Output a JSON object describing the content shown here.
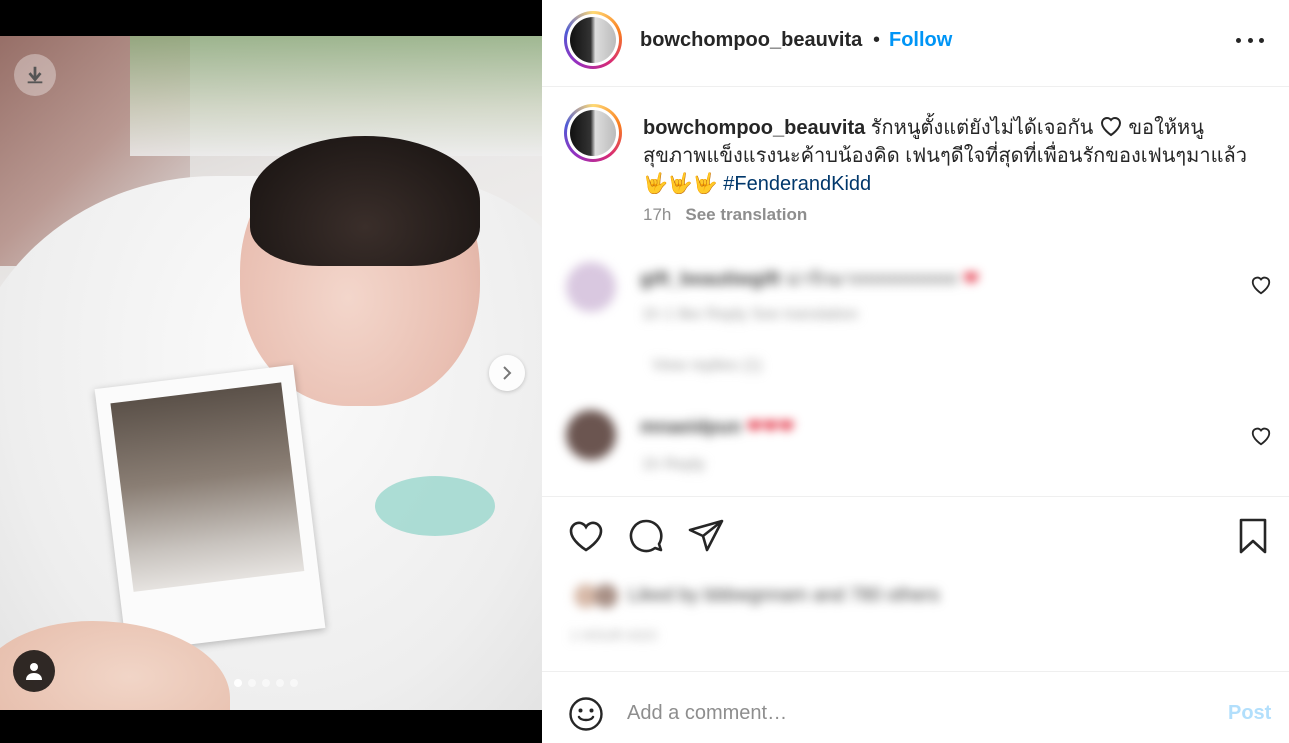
{
  "post": {
    "username": "bowchompoo_beauvita",
    "separator": "•",
    "follow_label": "Follow",
    "more_icon": "more-horizontal-icon"
  },
  "caption": {
    "username": "bowchompoo_beauvita",
    "text_part1": " รักหนูตั้งแต่ยังไม่ได้เจอกัน ",
    "text_part2": " ขอให้หนูสุขภาพแข็งแรงนะค้าบน้องคิด เฟนๆดีใจที่สุดที่เพื่อนรักของเฟนๆมาแล้ว ",
    "emoji_hands": "🤟🤟🤟",
    "hashtag": "#FenderandKidd",
    "time": "17h",
    "see_translation": "See translation"
  },
  "comments": [
    {
      "username": "gift_beautiwgift",
      "text": "น่ารักมากกกกกกกกก",
      "hearts": "❤",
      "meta": "1h   1 like   Reply   See translation",
      "replies": "View replies (1)"
    },
    {
      "username": "mnaeidpun",
      "text": "",
      "hearts": "❤❤❤",
      "meta": "1h   Reply"
    }
  ],
  "likes": {
    "text": "Liked by bbbwgnnam and 780 others",
    "time": "1 HOUR AGO"
  },
  "comment_bar": {
    "placeholder": "Add a comment…",
    "post_label": "Post"
  },
  "carousel": {
    "slide_count": 5,
    "active_index": 0
  },
  "colors": {
    "follow": "#0095f6",
    "hashtag": "#00376b",
    "post_disabled": "#b2dffc",
    "muted": "#8e8e8e"
  }
}
